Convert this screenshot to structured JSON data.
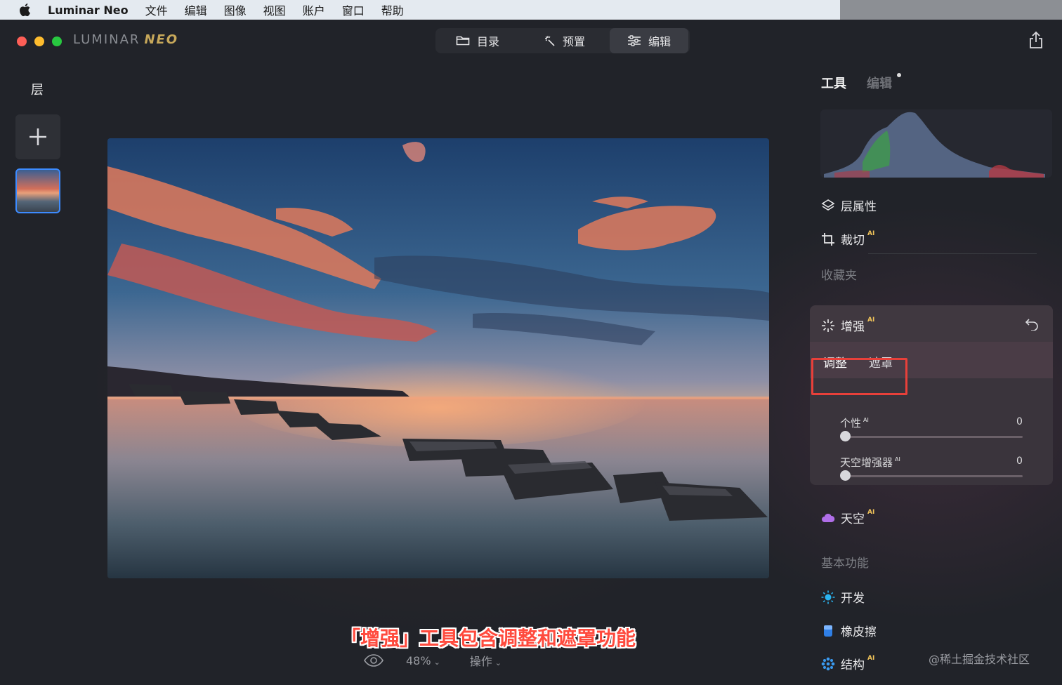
{
  "menubar": {
    "app_name": "Luminar Neo",
    "items": [
      "文件",
      "编辑",
      "图像",
      "视图",
      "账户",
      "窗口",
      "帮助"
    ]
  },
  "window": {
    "logo_main": "LUMINAR",
    "logo_sub": "NEO",
    "top_tabs": {
      "catalog": "目录",
      "presets": "预置",
      "edit": "编辑"
    }
  },
  "left_panel": {
    "title": "层"
  },
  "right_panel": {
    "tab_tools": "工具",
    "tab_edits": "编辑",
    "layer_properties": "层属性",
    "crop": "裁切",
    "favorites": "收藏夹",
    "enhance": {
      "title": "增强",
      "sub_tabs": {
        "adjust": "调整",
        "mask": "遮罩"
      },
      "sliders": [
        {
          "label": "个性",
          "value": "0"
        },
        {
          "label": "天空增强器",
          "value": "0"
        }
      ]
    },
    "sky": "天空",
    "basic_title": "基本功能",
    "develop": "开发",
    "eraser": "橡皮擦",
    "structure": "结构",
    "ai_badge": "AI"
  },
  "bottom_bar": {
    "zoom": "48%",
    "actions": "操作"
  },
  "caption": "「增强」工具包含调整和遮罩功能",
  "watermark": "@稀土掘金技术社区",
  "colors": {
    "accent_blue": "#3d8bff",
    "highlight_red": "#e8403a",
    "ai_gold": "#f0c35a"
  }
}
